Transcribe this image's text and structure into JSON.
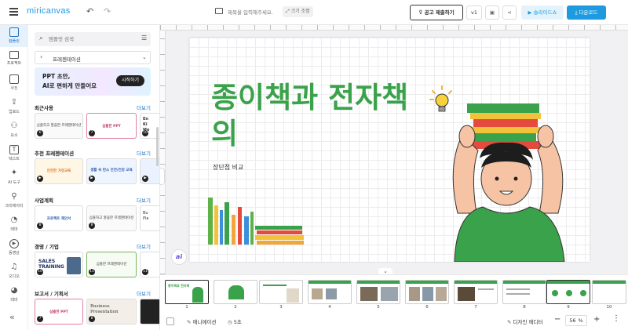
{
  "app": {
    "logo": "miricanvas",
    "title_placeholder": "제목을 입력해주세요.",
    "size_label": "크기 조정",
    "contest_button": "공고 제출하기",
    "version": "v1",
    "slideshow_label": "슬라이드쇼",
    "download_label": "다운로드",
    "colors": {
      "accent": "#1e9be0",
      "brand_green": "#3aa24a",
      "download": "#1e9be0"
    }
  },
  "nav": [
    {
      "label": "템플릿",
      "icon": "template-icon"
    },
    {
      "label": "프로젝트",
      "icon": "folder-icon"
    },
    {
      "label": "사진",
      "icon": "photo-icon"
    },
    {
      "label": "업로드",
      "icon": "upload-icon"
    },
    {
      "label": "요소",
      "icon": "elements-icon"
    },
    {
      "label": "텍스트",
      "icon": "text-icon"
    },
    {
      "label": "AI 도구",
      "icon": "ai-icon"
    },
    {
      "label": "크리에이터",
      "icon": "creator-icon"
    },
    {
      "label": "테마",
      "icon": "theme-icon"
    },
    {
      "label": "동영상",
      "icon": "video-icon"
    },
    {
      "label": "오디오",
      "icon": "audio-icon"
    },
    {
      "label": "테마",
      "icon": "palette-icon"
    }
  ],
  "panel": {
    "search_placeholder": "템플릿 검색",
    "category": "프레젠테이션",
    "banner_line1": "PPT 초안,",
    "banner_line2": "AI로 편하게 만들어요",
    "banner_button": "시작하기",
    "more": "더보기",
    "sections": [
      {
        "title": "최근사용",
        "items": [
          {
            "num": "6",
            "label": "심플하고 깔끔한 프레젠테이션"
          },
          {
            "num": "7",
            "label": "심플한 PPT"
          },
          {
            "num": "10",
            "label": "En Ki Me"
          }
        ]
      },
      {
        "title": "추천 프레젠테이션",
        "items": [
          {
            "num": "",
            "label": "안전한 가정교육"
          },
          {
            "num": "",
            "label": "생활 속 탄소 안전/건강 교육"
          },
          {
            "num": "",
            "label": ""
          }
        ]
      },
      {
        "title": "사업계획",
        "items": [
          {
            "num": "8",
            "label": "프로젝트 제안서"
          },
          {
            "num": "8",
            "label": "심플하고 깔끔한 프레젠테이션"
          },
          {
            "num": "",
            "label": "Bu Pla"
          }
        ]
      },
      {
        "title": "경영 / 기업",
        "items": [
          {
            "num": "10",
            "label": "SALES TRAINING"
          },
          {
            "num": "11",
            "label": "심플한 프레젠테이션"
          },
          {
            "num": "11",
            "label": ""
          }
        ]
      },
      {
        "title": "보고서 / 기획서",
        "items": [
          {
            "num": "7",
            "label": "심플한 PPT"
          },
          {
            "num": "8",
            "label": "Business Presentation"
          },
          {
            "num": "",
            "label": ""
          }
        ]
      }
    ]
  },
  "slide": {
    "title_line1": "종이책과 전자책",
    "title_line2": "의",
    "subtitle": "장단점 비교",
    "ai_badge": "ai"
  },
  "bottom": {
    "slides": [
      "1",
      "2",
      "3",
      "4",
      "5",
      "6",
      "7",
      "8",
      "9",
      "10"
    ],
    "animation_label": "애니메이션",
    "duration": "5초",
    "design_editor_label": "디자인 에디터",
    "zoom": "56",
    "zoom_unit": "%"
  }
}
